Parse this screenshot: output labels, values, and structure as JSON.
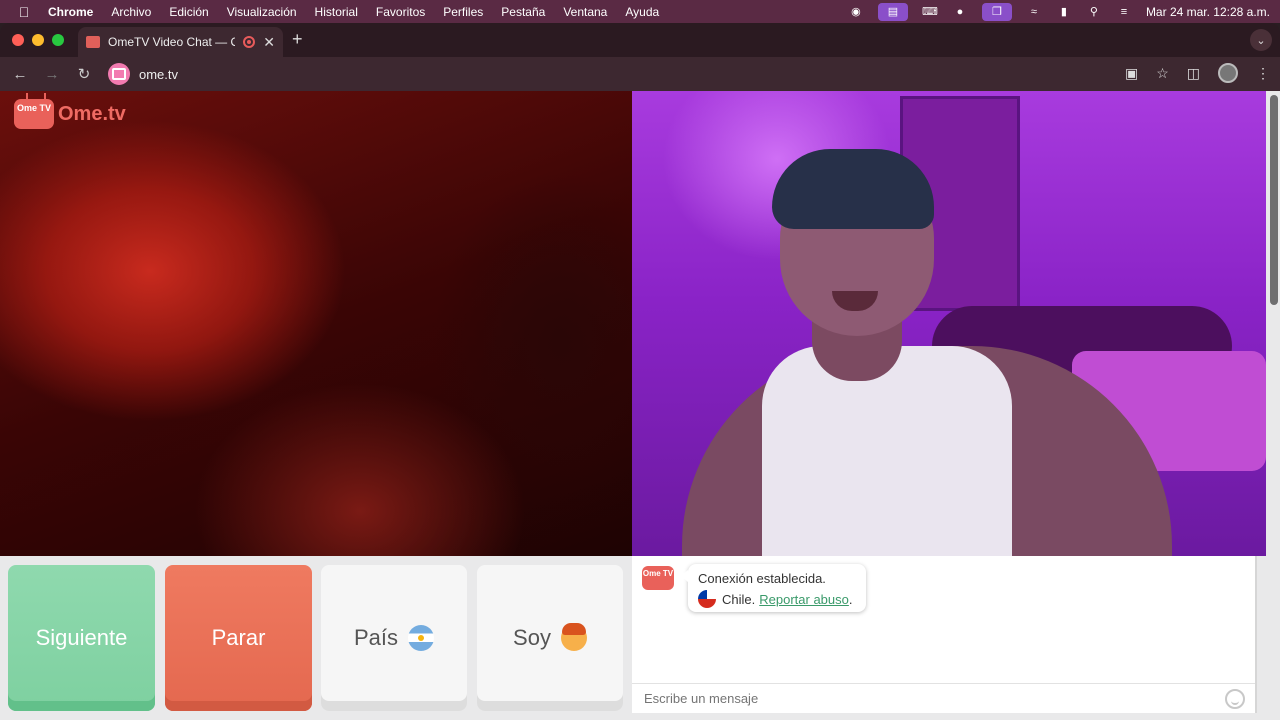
{
  "menubar": {
    "app": "Chrome",
    "items": [
      "Archivo",
      "Edición",
      "Visualización",
      "Historial",
      "Favoritos",
      "Perfiles",
      "Pestaña",
      "Ventana",
      "Ayuda"
    ],
    "clock": "Mar 24 mar. 12:28 a.m."
  },
  "browser": {
    "tab_title": "OmeTV Video Chat — Om",
    "url": "ome.tv"
  },
  "site": {
    "logo_badge": "Ome TV",
    "logo_text": "Ome.tv"
  },
  "controls": {
    "next": "Siguiente",
    "stop": "Parar",
    "country": "País",
    "gender": "Soy"
  },
  "chat": {
    "logo_badge": "Ome TV",
    "status": "Conexión establecida.",
    "country": "Chile.",
    "report_link": "Reportar abuso",
    "report_suffix": ".",
    "input_placeholder": "Escribe un mensaje"
  },
  "colors": {
    "next": "#8fd9ae",
    "stop": "#ef7a60",
    "brand": "#e9615a",
    "link": "#3a9a6a"
  }
}
